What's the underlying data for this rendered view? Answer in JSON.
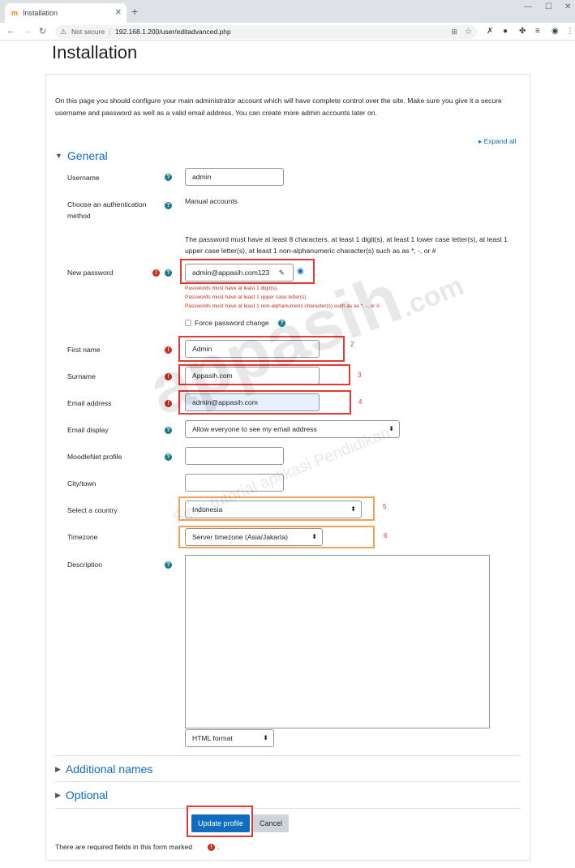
{
  "browser": {
    "tab_title": "Installation",
    "new_tab": "+",
    "not_secure": "Not secure",
    "url": "192.168.1.200/user/editadvanced.php"
  },
  "page": {
    "title": "Installation",
    "intro": "On this page you should configure your main administrator account which will have complete control over the site. Make sure you give it a secure username and password as well as a valid email address. You can create more admin accounts later on.",
    "expand_all": "Expand all"
  },
  "general": {
    "heading": "General",
    "username_label": "Username",
    "username_value": "admin",
    "auth_label": "Choose an authentication method",
    "auth_value": "Manual accounts",
    "password_rules": "The password must have at least 8 characters, at least 1 digit(s), at least 1 lower case letter(s), at least 1 upper case letter(s), at least 1 non-alphanumeric character(s) such as as *, -, or #",
    "new_password_label": "New password",
    "new_password_value": "admin@appasih.com123",
    "errors": [
      "Passwords must have at least 1 digit(s).",
      "Passwords must have at least 1 upper case letter(s).",
      "Passwords must have at least 1 non-alphanumeric character(s) such as as *, -, or #."
    ],
    "force_change_label": "Force password change",
    "first_name_label": "First name",
    "first_name_value": "Admin",
    "surname_label": "Surname",
    "surname_value": "Appasih.com",
    "email_label": "Email address",
    "email_value": "admin@appasih.com",
    "email_display_label": "Email display",
    "email_display_value": "Allow everyone to see my email address",
    "moodlenet_label": "MoodleNet profile",
    "city_label": "City/town",
    "country_label": "Select a country",
    "country_value": "Indonesia",
    "timezone_label": "Timezone",
    "timezone_value": "Server timezone (Asia/Jakarta)",
    "description_label": "Description",
    "format_value": "HTML format"
  },
  "sections": {
    "additional_names": "Additional names",
    "optional": "Optional"
  },
  "buttons": {
    "update_profile": "Update profile",
    "cancel": "Cancel"
  },
  "footer": {
    "required_note": "There are required fields in this form marked",
    "period": "."
  },
  "annotations": {
    "n2": "2",
    "n3": "3",
    "n4": "4",
    "n5": "5",
    "n6": "6"
  },
  "watermark": {
    "brand": "appasih",
    "domain": ".com",
    "tagline": "Situs tutorial aplikasi Pendidikan"
  },
  "colors": {
    "accent": "#0f6cbf",
    "error": "#ca3120",
    "annotation_red": "#e53935",
    "annotation_orange": "#f4a25a"
  }
}
